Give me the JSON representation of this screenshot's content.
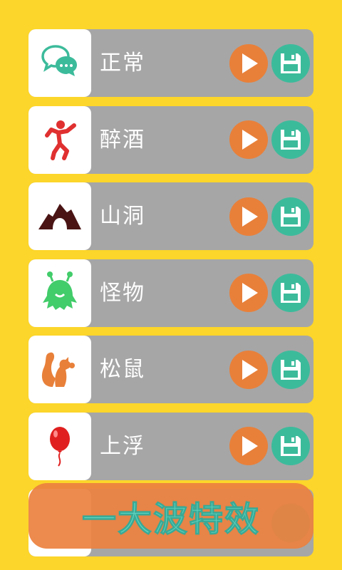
{
  "effects": [
    {
      "label": "正常",
      "icon": "speech-bubble-icon",
      "icon_color": "#3cbb9b"
    },
    {
      "label": "醉酒",
      "icon": "drunk-person-icon",
      "icon_color": "#e03030"
    },
    {
      "label": "山洞",
      "icon": "cave-icon",
      "icon_color": "#4a1414"
    },
    {
      "label": "怪物",
      "icon": "monster-icon",
      "icon_color": "#42cc6a"
    },
    {
      "label": "松鼠",
      "icon": "squirrel-icon",
      "icon_color": "#e8803a"
    },
    {
      "label": "上浮",
      "icon": "balloon-icon",
      "icon_color": "#e02020"
    }
  ],
  "banner": {
    "label": "一大波特效"
  },
  "colors": {
    "background": "#fcd62a",
    "row": "#a6a6a6",
    "play": "#e8803a",
    "save": "#3cbb9b",
    "banner": "#ec8140",
    "banner_text": "#5ed3c0"
  }
}
